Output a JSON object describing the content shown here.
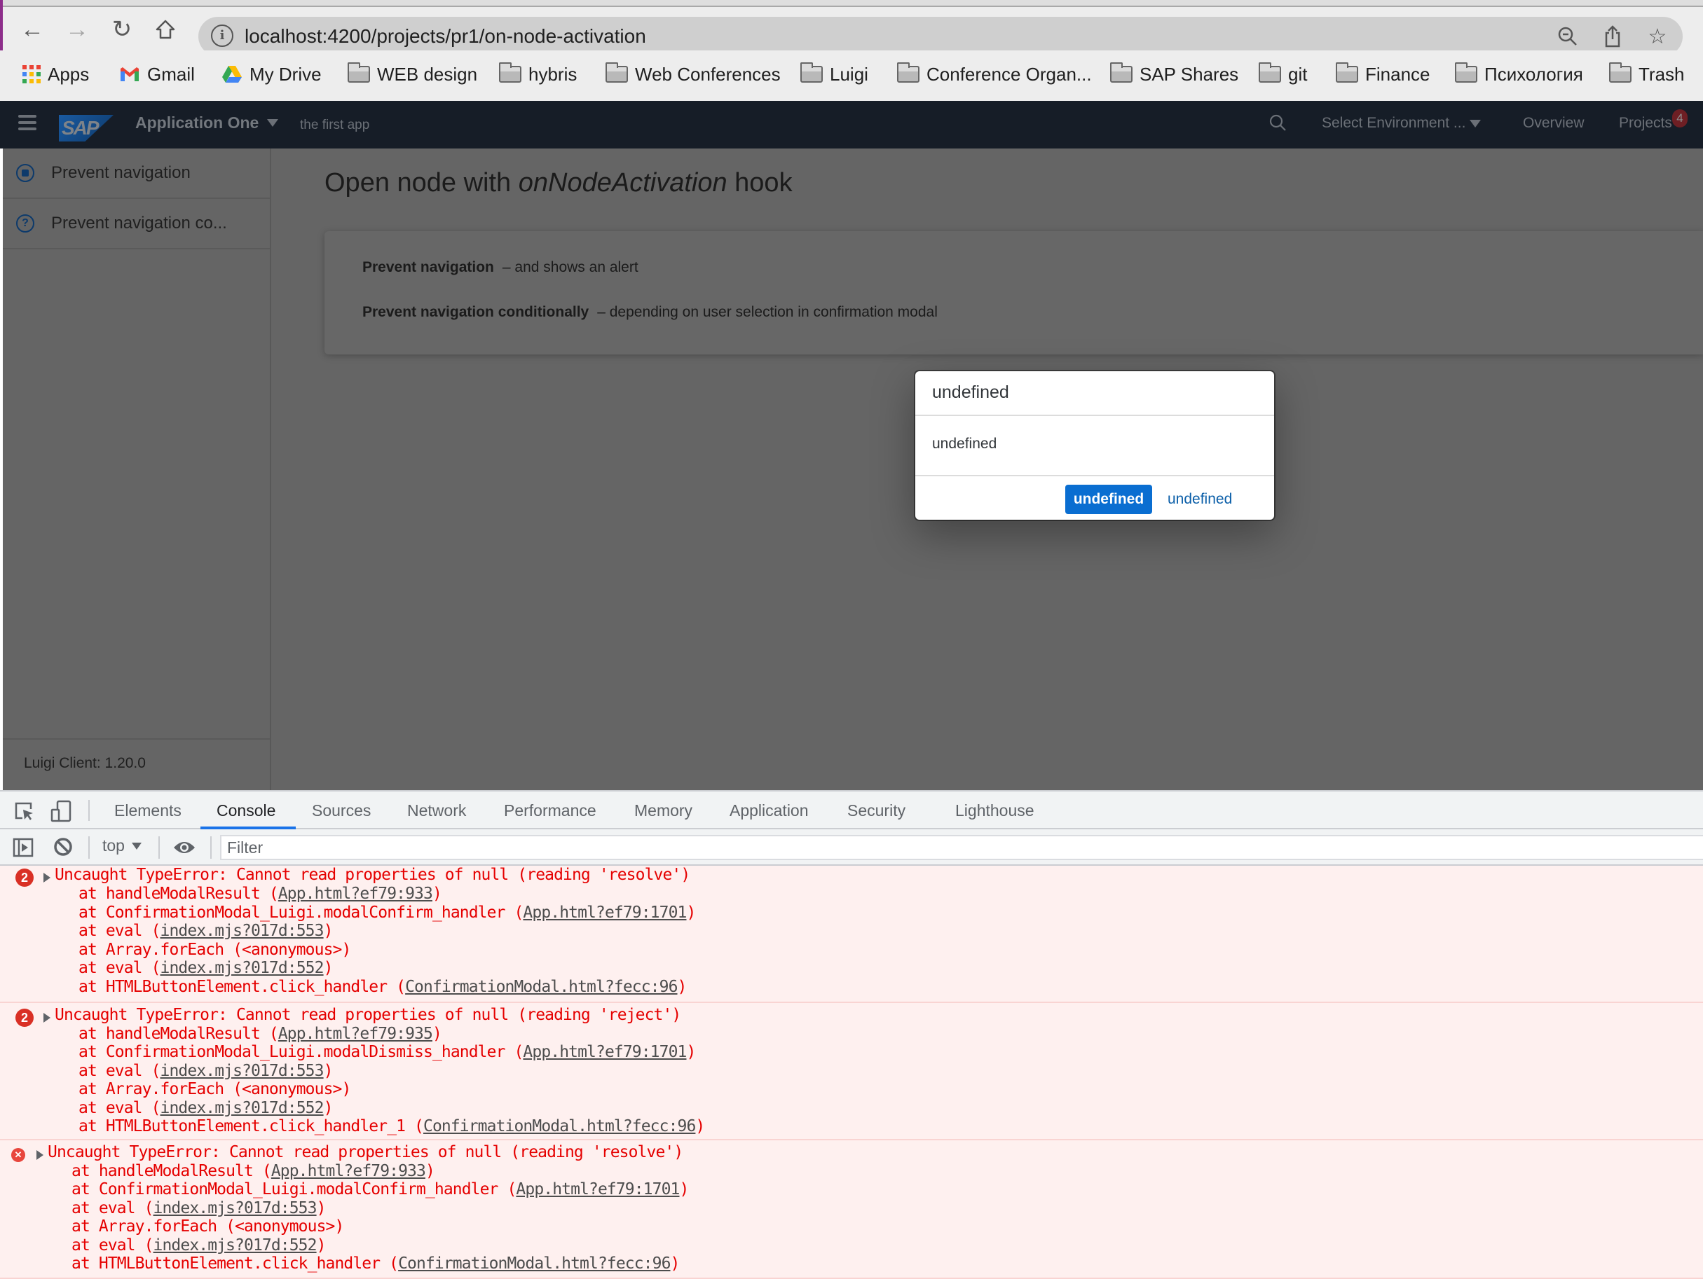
{
  "browser": {
    "url": "localhost:4200/projects/pr1/on-node-activation",
    "nav": {
      "back": "back-icon",
      "forward": "forward-icon",
      "reload": "reload-icon",
      "home": "home-icon"
    },
    "url_icons": [
      "zoom-out-icon",
      "share-icon",
      "bookmark-star-icon"
    ],
    "bookmarks": [
      {
        "label": "Apps",
        "icon": "apps-grid-icon"
      },
      {
        "label": "Gmail",
        "icon": "gmail-icon"
      },
      {
        "label": "My Drive",
        "icon": "drive-icon"
      },
      {
        "label": "WEB design",
        "icon": "folder-icon"
      },
      {
        "label": "hybris",
        "icon": "folder-icon"
      },
      {
        "label": "Web Conferences",
        "icon": "folder-icon"
      },
      {
        "label": "Luigi",
        "icon": "folder-icon"
      },
      {
        "label": "Conference Organ...",
        "icon": "folder-icon"
      },
      {
        "label": "SAP Shares",
        "icon": "folder-icon"
      },
      {
        "label": "git",
        "icon": "folder-icon"
      },
      {
        "label": "Finance",
        "icon": "folder-icon"
      },
      {
        "label": "Психология",
        "icon": "folder-icon"
      },
      {
        "label": "Trash",
        "icon": "folder-icon"
      }
    ]
  },
  "shellbar": {
    "logo": "SAP",
    "app_title": "Application One",
    "app_subtitle": "the first app",
    "environment": "Select Environment ...",
    "overview": "Overview",
    "projects": "Projects",
    "projects_badge": "4"
  },
  "sidebar": {
    "items": [
      {
        "label": "Prevent navigation",
        "icon": "stop-circle-icon"
      },
      {
        "label": "Prevent navigation co...",
        "icon": "question-circle-icon"
      }
    ],
    "footer": "Luigi Client: 1.20.0"
  },
  "main": {
    "title_prefix": "Open node with ",
    "title_em": "onNodeActivation",
    "title_suffix": " hook",
    "rows": [
      {
        "bold": "Prevent navigation",
        "desc": "– and shows an alert"
      },
      {
        "bold": "Prevent navigation conditionally",
        "desc": "– depending on user selection in confirmation modal"
      }
    ]
  },
  "modal": {
    "header": "undefined",
    "body": "undefined",
    "confirm": "undefined",
    "dismiss": "undefined",
    "confirm_color": "#0a6ed1"
  },
  "devtools": {
    "tabs": [
      "Elements",
      "Console",
      "Sources",
      "Network",
      "Performance",
      "Memory",
      "Application",
      "Security",
      "Lighthouse"
    ],
    "active_tab": "Console",
    "context": "top",
    "filter_placeholder": "Filter",
    "errors": [
      {
        "count": "2",
        "message": "Uncaught TypeError: Cannot read properties of null (reading 'resolve')",
        "stack": [
          {
            "fn": "at handleModalResult (",
            "src": "App.html?ef79:933",
            "end": ")"
          },
          {
            "fn": "at ConfirmationModal_Luigi.modalConfirm_handler (",
            "src": "App.html?ef79:1701",
            "end": ")"
          },
          {
            "fn": "at eval (",
            "src": "index.mjs?017d:553",
            "end": ")"
          },
          {
            "fn": "at Array.forEach (<anonymous>)",
            "src": "",
            "end": ""
          },
          {
            "fn": "at eval (",
            "src": "index.mjs?017d:552",
            "end": ")"
          },
          {
            "fn": "at HTMLButtonElement.click_handler (",
            "src": "ConfirmationModal.html?fecc:96",
            "end": ")"
          }
        ]
      },
      {
        "count": "2",
        "message": "Uncaught TypeError: Cannot read properties of null (reading 'reject')",
        "stack": [
          {
            "fn": "at handleModalResult (",
            "src": "App.html?ef79:935",
            "end": ")"
          },
          {
            "fn": "at ConfirmationModal_Luigi.modalDismiss_handler (",
            "src": "App.html?ef79:1701",
            "end": ")"
          },
          {
            "fn": "at eval (",
            "src": "index.mjs?017d:553",
            "end": ")"
          },
          {
            "fn": "at Array.forEach (<anonymous>)",
            "src": "",
            "end": ""
          },
          {
            "fn": "at eval (",
            "src": "index.mjs?017d:552",
            "end": ")"
          },
          {
            "fn": "at HTMLButtonElement.click_handler_1 (",
            "src": "ConfirmationModal.html?fecc:96",
            "end": ")"
          }
        ]
      },
      {
        "count": "",
        "message": "Uncaught TypeError: Cannot read properties of null (reading 'resolve')",
        "stack": [
          {
            "fn": "at handleModalResult (",
            "src": "App.html?ef79:933",
            "end": ")"
          },
          {
            "fn": "at ConfirmationModal_Luigi.modalConfirm_handler (",
            "src": "App.html?ef79:1701",
            "end": ")"
          },
          {
            "fn": "at eval (",
            "src": "index.mjs?017d:553",
            "end": ")"
          },
          {
            "fn": "at Array.forEach (<anonymous>)",
            "src": "",
            "end": ""
          },
          {
            "fn": "at eval (",
            "src": "index.mjs?017d:552",
            "end": ")"
          },
          {
            "fn": "at HTMLButtonElement.click_handler (",
            "src": "ConfirmationModal.html?fecc:96",
            "end": ")"
          }
        ]
      }
    ]
  }
}
